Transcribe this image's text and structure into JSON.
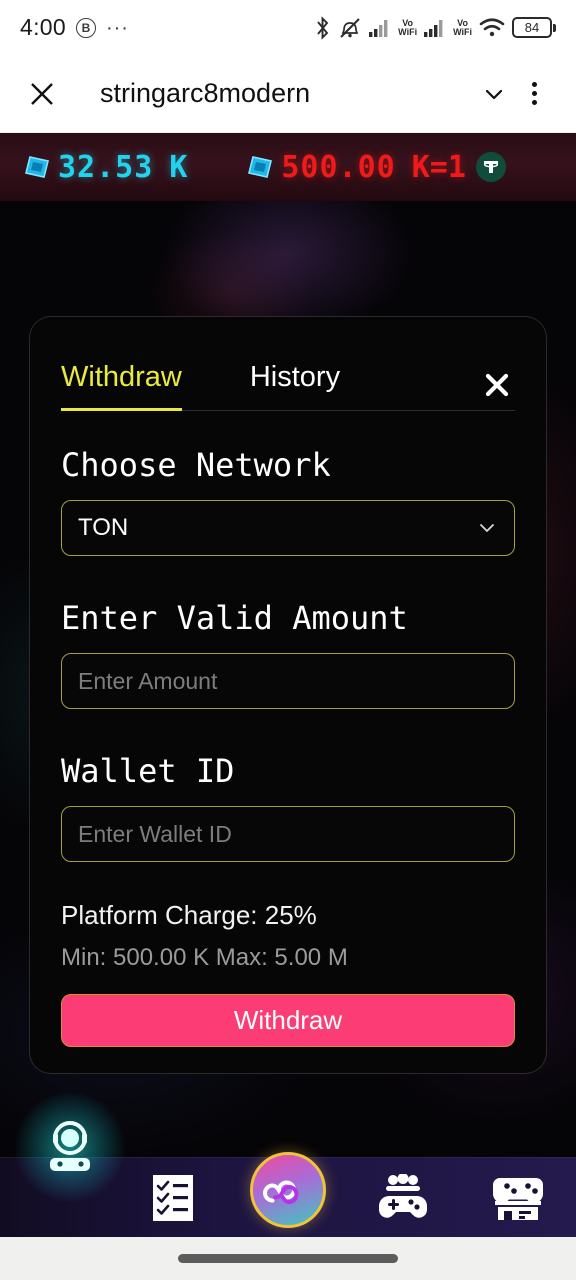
{
  "status_bar": {
    "time": "4:00",
    "b_badge": "B",
    "overflow_dots": "···",
    "vowifi_label_1": "Vo",
    "wifi_label_1": "WiFi",
    "vowifi_label_2": "Vo",
    "wifi_label_2": "WiFi",
    "battery_level": "84",
    "icons": [
      "bluetooth-icon",
      "vibrate-off-icon",
      "signal-icon",
      "vowifi-icon",
      "signal-icon",
      "vowifi-icon",
      "wifi-icon",
      "battery-icon"
    ]
  },
  "app_bar": {
    "title": "stringarc8modern",
    "close_icon": "close-icon",
    "chevron_icon": "chevron-down-icon",
    "menu_icon": "kebab-menu-icon"
  },
  "balance_bar": {
    "primary": {
      "icon": "gem-icon",
      "amount": "32.53",
      "unit": "K",
      "color": "#22d3ee"
    },
    "secondary": {
      "icon": "gem-icon",
      "amount": "500.00",
      "unit": "K=1",
      "color": "#ef1a1a",
      "token_icon": "usdt-icon"
    }
  },
  "modal": {
    "tabs": [
      {
        "label": "Withdraw",
        "active": true
      },
      {
        "label": "History",
        "active": false
      }
    ],
    "close_icon": "close-icon",
    "network": {
      "label": "Choose Network",
      "selected": "TON",
      "options": [
        "TON"
      ],
      "chevron": "chevron-down-icon"
    },
    "amount": {
      "label": "Enter Valid Amount",
      "value": "",
      "placeholder": "Enter Amount"
    },
    "wallet": {
      "label": "Wallet ID",
      "value": "",
      "placeholder": "Enter Wallet ID"
    },
    "platform_charge": "Platform Charge: 25%",
    "min_max": "Min: 500.00 K Max: 5.00 M",
    "submit_label": "Withdraw",
    "accent_color": "#eaea3c",
    "button_color": "#fc3c75",
    "border_color": "#a0a040"
  },
  "bottom_nav": {
    "items": [
      {
        "name": "profile-avatar",
        "icon": "gamer-avatar-icon"
      },
      {
        "name": "tasks",
        "icon": "checklist-icon"
      },
      {
        "name": "home-coin",
        "icon": "infinity-coin-icon"
      },
      {
        "name": "multiplayer",
        "icon": "gamepad-people-icon"
      },
      {
        "name": "game-store",
        "icon": "arcade-store-icon"
      }
    ]
  }
}
